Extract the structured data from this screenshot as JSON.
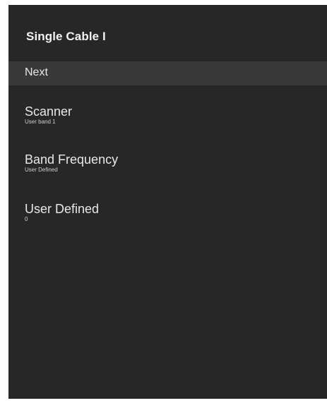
{
  "screen": {
    "title": "Single Cable I"
  },
  "menu": {
    "next_label": "Next",
    "items": [
      {
        "label": "Scanner",
        "value": "User band 1"
      },
      {
        "label": "Band Frequency",
        "value": "User Defined"
      },
      {
        "label": "User Defined",
        "value": "0"
      }
    ]
  },
  "colors": {
    "panel_background": "#282727",
    "highlight_row": "#3a3939",
    "text_primary": "#e8e8e8",
    "outer_background": "#ffffff"
  }
}
